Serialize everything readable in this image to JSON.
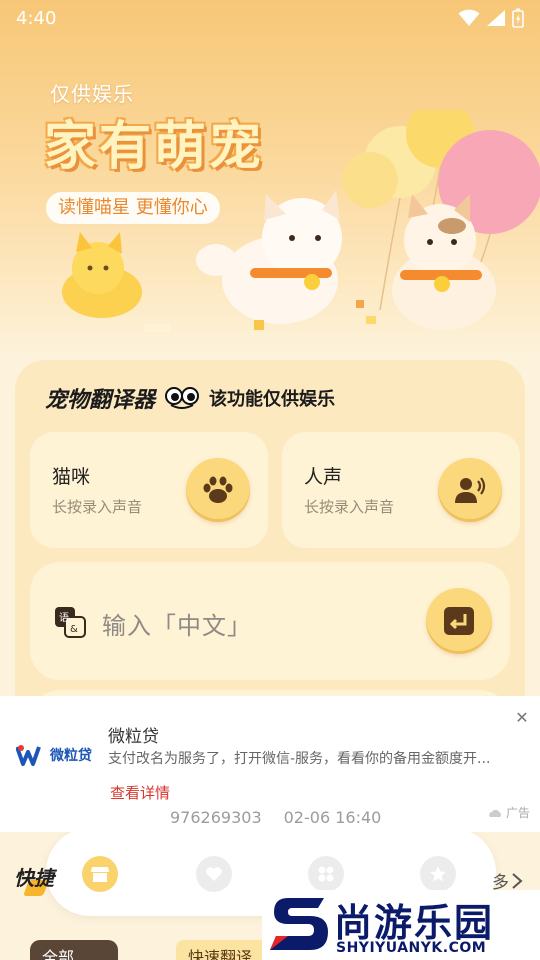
{
  "status_bar": {
    "time": "4:40"
  },
  "hero": {
    "subtitle": "仅供娱乐",
    "title": "家有萌宠",
    "tagline": "读懂喵星 更懂你心"
  },
  "translator": {
    "title": "宠物翻译器",
    "note": "该功能仅供娱乐",
    "modes": [
      {
        "title": "猫咪",
        "desc": "长按录入声音",
        "icon": "paw-icon"
      },
      {
        "title": "人声",
        "desc": "长按录入声音",
        "icon": "voice-icon"
      }
    ],
    "input": {
      "placeholder": "输入「中文」"
    }
  },
  "ad": {
    "logo_text": "微粒贷",
    "title": "微粒贷",
    "description": "支付改名为服务了，打开微信-服务，看看你的备用金额度开...",
    "link": "查看详情",
    "label": "广告",
    "number": "976269303",
    "datetime": "02-06 16:40"
  },
  "section": {
    "quick_title": "快捷",
    "more": "多",
    "chip_all": "全部",
    "chip_fast": "快速翻译"
  },
  "tabbar": {
    "icons": [
      "shop-icon",
      "heart-icon",
      "grid-icon",
      "star-icon"
    ]
  },
  "watermark": {
    "cn": "尚游乐园",
    "en": "SHYIYUANYK.COM"
  },
  "colors": {
    "accent": "#fad87b",
    "card": "#fff3d6",
    "panel": "#fde9c0",
    "ad_link": "#d9352b"
  }
}
